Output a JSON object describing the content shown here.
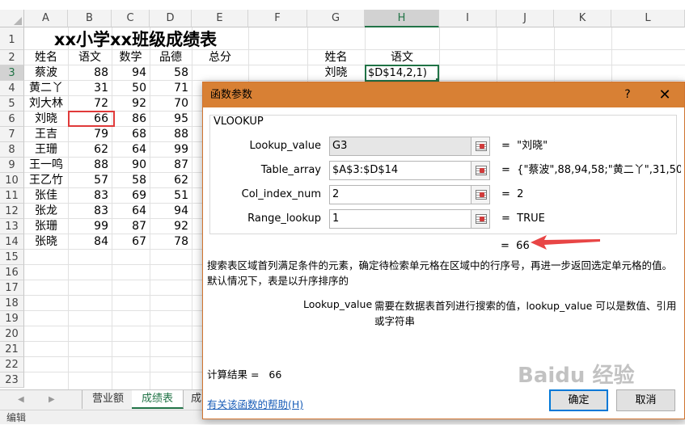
{
  "columns": [
    "A",
    "B",
    "C",
    "D",
    "E",
    "F",
    "G",
    "H",
    "I",
    "J",
    "K",
    "L"
  ],
  "rows": [
    "1",
    "2",
    "3",
    "4",
    "5",
    "6",
    "7",
    "8",
    "9",
    "10",
    "11",
    "12",
    "13",
    "14",
    "15",
    "16",
    "17",
    "18",
    "19",
    "20",
    "21",
    "22",
    "23"
  ],
  "sheet_title": "xx小学xx班级成绩表",
  "headers": {
    "name": "姓名",
    "chinese": "语文",
    "math": "数学",
    "moral": "品德",
    "total": "总分"
  },
  "students": [
    {
      "name": "蔡波",
      "chinese": "88",
      "math": "94",
      "moral": "58"
    },
    {
      "name": "黄二丫",
      "chinese": "31",
      "math": "50",
      "moral": "71"
    },
    {
      "name": "刘大林",
      "chinese": "72",
      "math": "92",
      "moral": "70"
    },
    {
      "name": "刘晓",
      "chinese": "66",
      "math": "86",
      "moral": "95"
    },
    {
      "name": "王吉",
      "chinese": "79",
      "math": "68",
      "moral": "88"
    },
    {
      "name": "王珊",
      "chinese": "62",
      "math": "64",
      "moral": "99"
    },
    {
      "name": "王一鸣",
      "chinese": "88",
      "math": "90",
      "moral": "87"
    },
    {
      "name": "王乙竹",
      "chinese": "57",
      "math": "58",
      "moral": "62"
    },
    {
      "name": "张佳",
      "chinese": "83",
      "math": "69",
      "moral": "51"
    },
    {
      "name": "张龙",
      "chinese": "83",
      "math": "64",
      "moral": "94"
    },
    {
      "name": "张珊",
      "chinese": "99",
      "math": "87",
      "moral": "92"
    },
    {
      "name": "张晓",
      "chinese": "84",
      "math": "67",
      "moral": "78"
    }
  ],
  "lookup": {
    "name_header": "姓名",
    "chinese_header": "语文",
    "name_value": "刘晓",
    "formula_tail": "$D$14,2,1)"
  },
  "tabs": [
    "营业额",
    "成绩表",
    "成"
  ],
  "status": "编辑",
  "dialog": {
    "title": "函数参数",
    "help_glyph": "?",
    "close_glyph": "✕",
    "function_name": "VLOOKUP",
    "args": [
      {
        "label": "Lookup_value",
        "input": "G3",
        "result": "\"刘晓\""
      },
      {
        "label": "Table_array",
        "input": "$A$3:$D$14",
        "result": "{\"蔡波\",88,94,58;\"黄二丫\",31,50,71..."
      },
      {
        "label": "Col_index_num",
        "input": "2",
        "result": "2"
      },
      {
        "label": "Range_lookup",
        "input": "1",
        "result": "TRUE"
      }
    ],
    "eq": "=",
    "result_value": "66",
    "description": "搜索表区域首列满足条件的元素，确定待检索单元格在区域中的行序号，再进一步返回选定单元格的值。默认情况下，表是以升序排序的",
    "arg_help_name": "Lookup_value",
    "arg_help_text": "需要在数据表首列进行搜索的值，lookup_value 可以是数值、引用或字符串",
    "calc_label": "计算结果 =",
    "calc_value": "66",
    "help_link": "有关该函数的帮助(H)",
    "ok": "确定",
    "cancel": "取消"
  },
  "watermark": "Baidu 经验",
  "colors": {
    "excel_green": "#217346",
    "dialog_title": "#d88034",
    "highlight_red": "#e03a3a"
  }
}
